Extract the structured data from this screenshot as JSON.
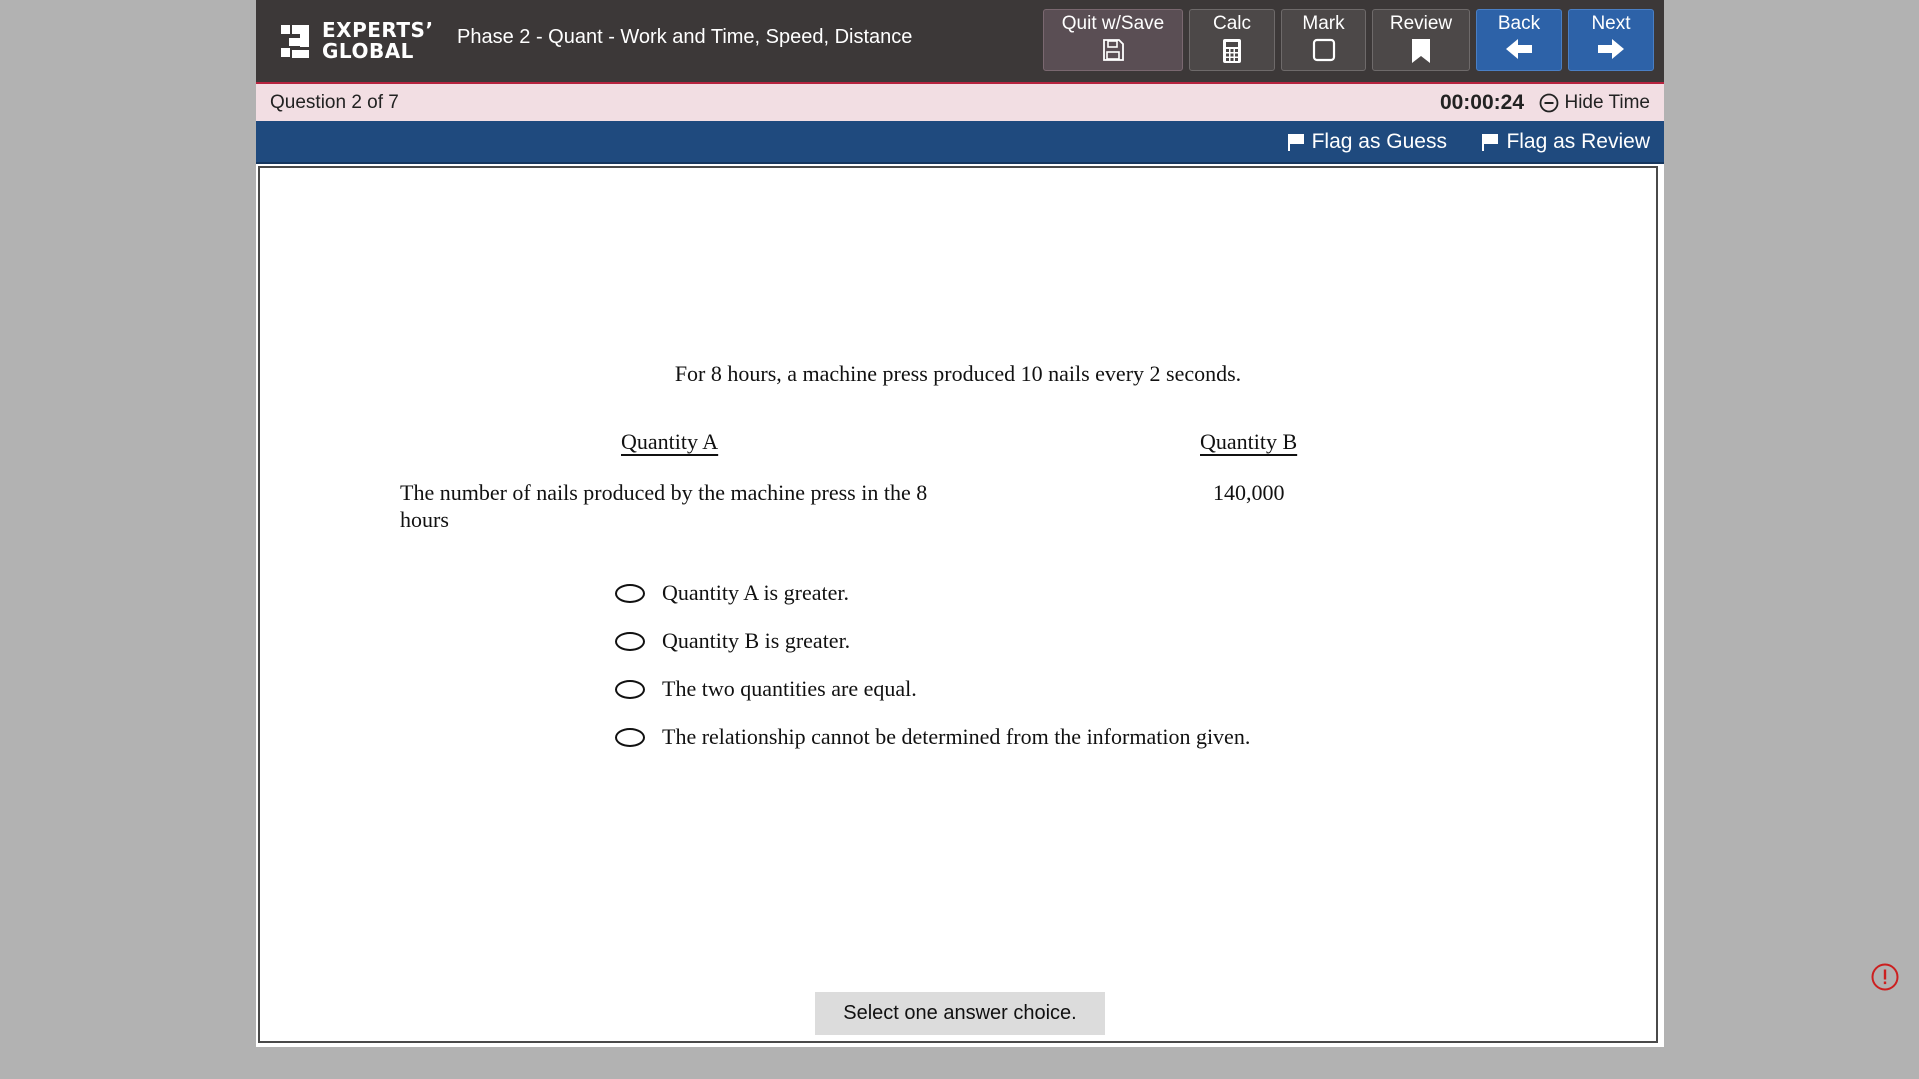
{
  "header": {
    "logo_line1": "EXPERTS’",
    "logo_line2": "GLOBAL",
    "section_title": "Phase 2 - Quant - Work and Time, Speed, Distance"
  },
  "toolbar": {
    "quit_label": "Quit w/Save",
    "calc_label": "Calc",
    "mark_label": "Mark",
    "review_label": "Review",
    "back_label": "Back",
    "next_label": "Next"
  },
  "status": {
    "question_count": "Question 2 of 7",
    "timer": "00:00:24",
    "hide_time_label": "Hide Time"
  },
  "flags": {
    "guess_label": "Flag as Guess",
    "review_label": "Flag as Review"
  },
  "question": {
    "stem": "For 8 hours, a machine press produced 10 nails every 2 seconds.",
    "quantity_a_heading": "Quantity A",
    "quantity_b_heading": "Quantity B",
    "quantity_a_text": "The number of nails produced by the machine press in the 8 hours",
    "quantity_b_text": "140,000",
    "choices": [
      "Quantity A is greater.",
      "Quantity B is greater.",
      "The two quantities are equal.",
      "The relationship cannot be determined from the information given."
    ],
    "instruction": "Select one answer choice."
  },
  "colors": {
    "header_bg": "#3c3838",
    "nav_blue": "#2d62a8",
    "flag_bar": "#1f4a7e",
    "question_bar": "#f2dee3",
    "accent_red": "#b7243f"
  }
}
